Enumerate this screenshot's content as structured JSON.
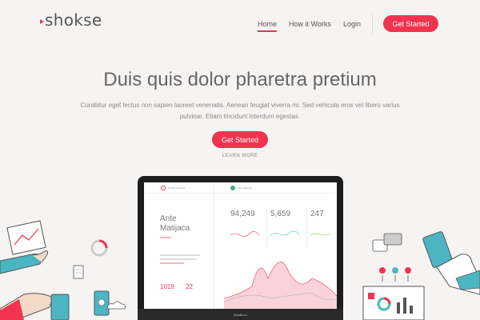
{
  "brand": {
    "name": "shokse"
  },
  "nav": {
    "items": [
      "Home",
      "How it Works",
      "Login"
    ],
    "cta": "Get Started"
  },
  "hero": {
    "title": "Duis quis dolor pharetra pretium",
    "subtitle": "Curabitur eget lectus non sapien laoreet venenatis. Aenean feugiat viverra mi. Sed vehicula eros vel libero varius pulvinar. Etiam tincidunt interdum egestas.",
    "cta": "Get Started",
    "learn_more": "LEARN MORE"
  },
  "screen": {
    "app_label": "Profile Overview",
    "user_label": "Ante Matijaca",
    "profile_name": "Ante Matijaca",
    "stats": [
      "94,249",
      "5,659",
      "247"
    ],
    "bottom_stats": [
      "1019",
      "22"
    ],
    "laptop_brand": "MacBook"
  },
  "colors": {
    "accent": "#f0344f",
    "teal": "#4bb6c2"
  }
}
